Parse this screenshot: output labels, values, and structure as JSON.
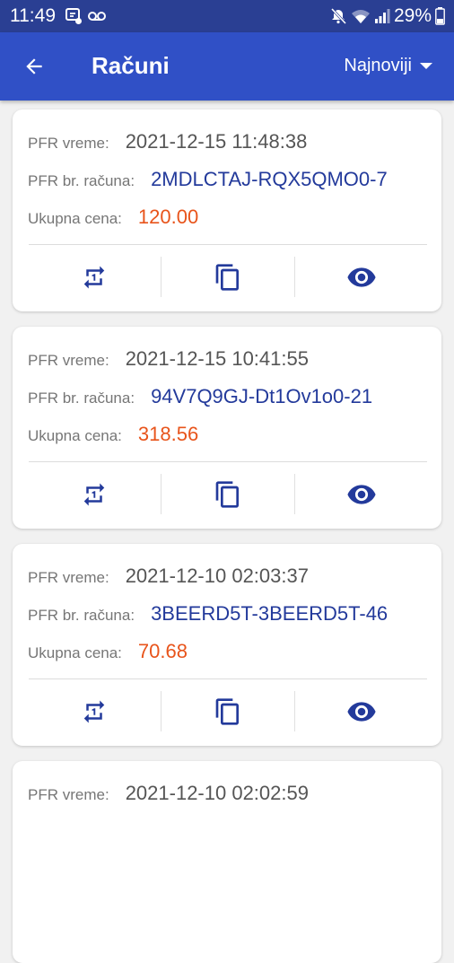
{
  "status_bar": {
    "time": "11:49",
    "battery": "29%"
  },
  "app_bar": {
    "title": "Računi",
    "sort_label": "Najnoviji"
  },
  "receipt_labels": {
    "time_label": "PFR vreme:",
    "number_label": "PFR br. računa:",
    "total_label": "Ukupna cena:"
  },
  "receipts": [
    {
      "time": "2021-12-15 11:48:38",
      "number": "2MDLCTAJ-RQX5QMO0-7",
      "total": "120.00"
    },
    {
      "time": "2021-12-15 10:41:55",
      "number": "94V7Q9GJ-Dt1Ov1o0-21",
      "total": "318.56"
    },
    {
      "time": "2021-12-10 02:03:37",
      "number": "3BEERD5T-3BEERD5T-46",
      "total": "70.68"
    },
    {
      "time": "2021-12-10 02:02:59"
    }
  ],
  "icons": {
    "back": "arrow-back-icon",
    "dropdown": "arrow-drop-down-icon",
    "repeat": "repeat-one-icon",
    "copy": "copy-icon",
    "view": "eye-icon"
  },
  "colors": {
    "status_bar": "#2a3f93",
    "app_bar": "#3050c6",
    "accent": "#233a9b",
    "price": "#e8541b",
    "background": "#f1f1f1"
  }
}
